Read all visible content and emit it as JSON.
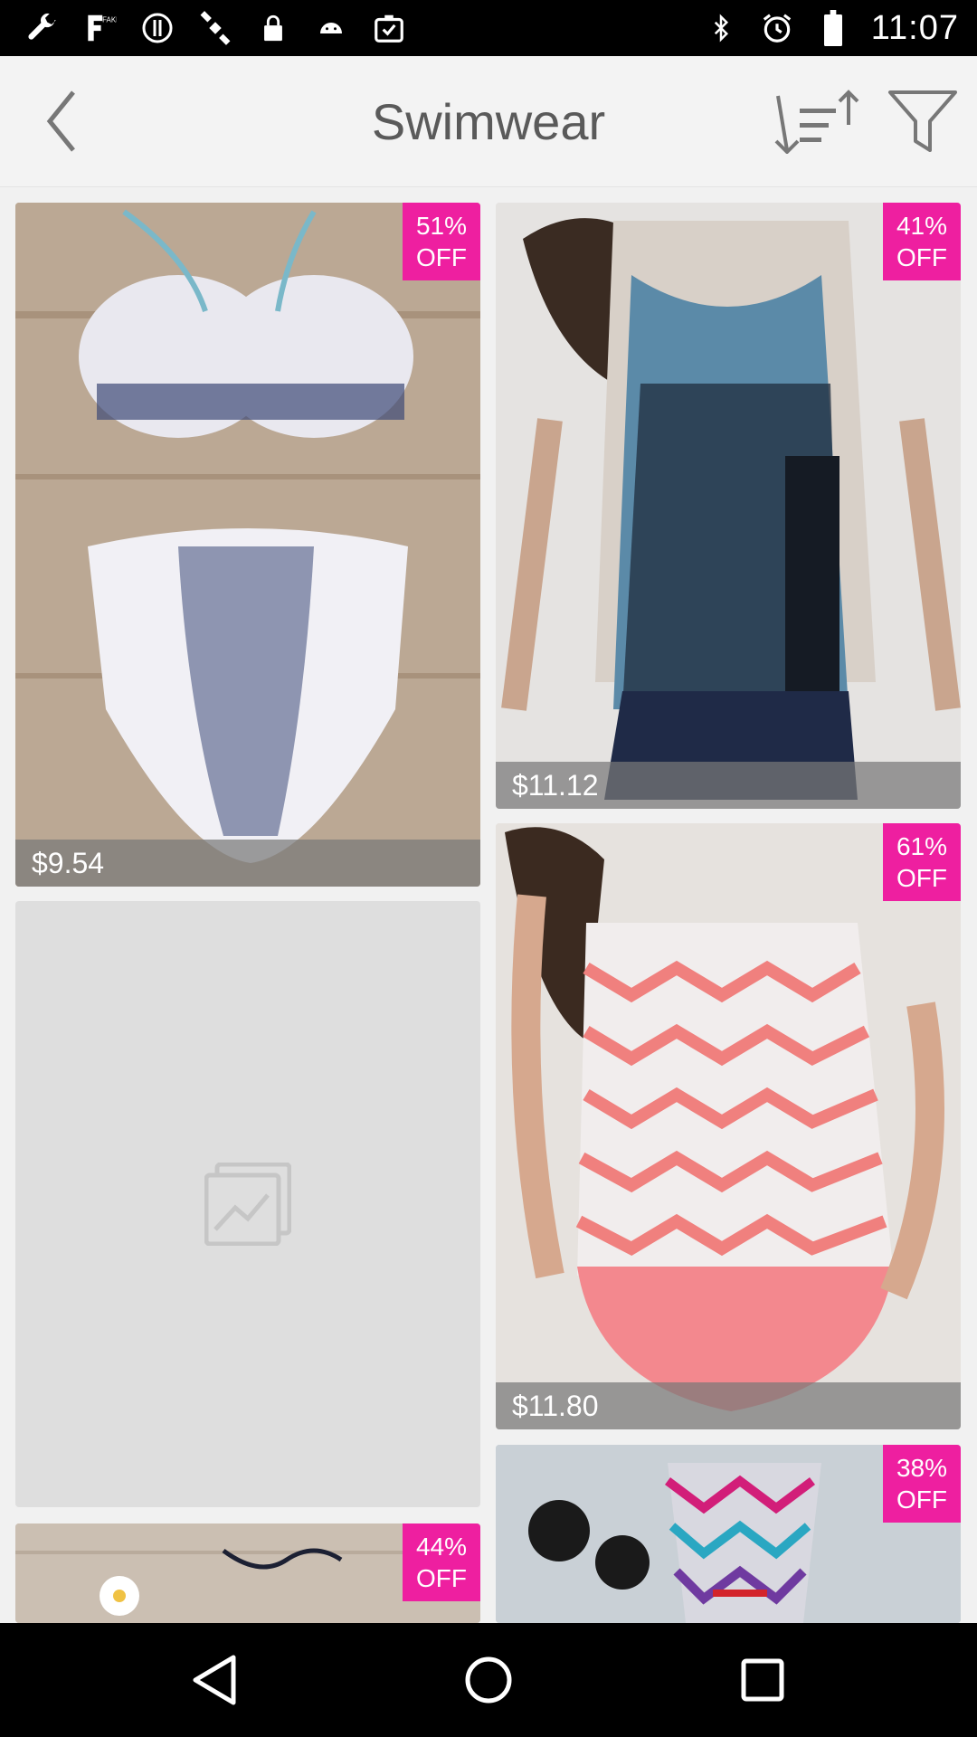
{
  "status_bar": {
    "time": "11:07",
    "left_icons": [
      "wrench-icon",
      "fake-gps-icon",
      "cancel-circle-icon",
      "satellite-icon",
      "lock-icon",
      "android-icon",
      "task-icon"
    ],
    "right_icons": [
      "bluetooth-icon",
      "alarm-icon",
      "battery-icon"
    ]
  },
  "header": {
    "title": "Swimwear",
    "back_icon": "chevron-left-icon",
    "sort_icon": "sort-icon",
    "filter_icon": "filter-icon"
  },
  "products": [
    {
      "discount_value": "51%",
      "discount_label": "OFF",
      "price": "$9.54"
    },
    {
      "discount_value": "41%",
      "discount_label": "OFF",
      "price": "$11.12"
    },
    {
      "discount_value": "",
      "discount_label": "",
      "price": "",
      "loading": true
    },
    {
      "discount_value": "61%",
      "discount_label": "OFF",
      "price": "$11.80"
    },
    {
      "discount_value": "44%",
      "discount_label": "OFF",
      "price": ""
    },
    {
      "discount_value": "38%",
      "discount_label": "OFF",
      "price": ""
    }
  ],
  "colors": {
    "badge": "#ee1fa0",
    "title": "#5a5a5a",
    "background": "#f1f1f1"
  },
  "nav": {
    "back_icon": "triangle-back-icon",
    "home_icon": "circle-home-icon",
    "recents_icon": "square-recents-icon"
  }
}
